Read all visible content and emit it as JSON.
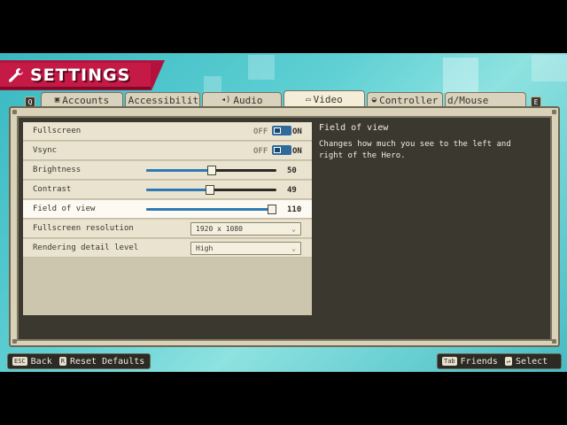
{
  "header": {
    "title": "SETTINGS"
  },
  "tabs": {
    "prev_key": "Q",
    "next_key": "E",
    "items": [
      {
        "icon": "▣",
        "label": "Accounts"
      },
      {
        "icon": "♖",
        "label": "Accessibility"
      },
      {
        "icon": "◂)",
        "label": "Audio"
      },
      {
        "icon": "▭",
        "label": "Video",
        "active": true
      },
      {
        "icon": "◒",
        "label": "Controller"
      },
      {
        "icon": "",
        "label": "d/Mouse"
      }
    ]
  },
  "settings": {
    "fullscreen": {
      "label": "Fullscreen",
      "off": "OFF",
      "on": "ON"
    },
    "vsync": {
      "label": "Vsync",
      "off": "OFF",
      "on": "ON"
    },
    "brightness": {
      "label": "Brightness",
      "value": "50",
      "level": 0.5
    },
    "contrast": {
      "label": "Contrast",
      "value": "49",
      "level": 0.49
    },
    "fov": {
      "label": "Field of view",
      "value": "110",
      "level": 1.0
    },
    "resolution": {
      "label": "Fullscreen resolution",
      "value": "1920 x 1080"
    },
    "detail": {
      "label": "Rendering detail level",
      "value": "High"
    }
  },
  "description": {
    "title": "Field of view",
    "text": "Changes how much you see to the left and right of the Hero."
  },
  "footer": {
    "back_key": "ESC",
    "back_label": "Back",
    "reset_key": "R",
    "reset_label": "Reset Defaults",
    "friends_key": "Tab",
    "friends_label": "Friends",
    "select_key": "↵",
    "select_label": "Select"
  },
  "colors": {
    "accent": "#2f7ab5",
    "banner": "#c41a45",
    "background": "#39b9c0"
  }
}
